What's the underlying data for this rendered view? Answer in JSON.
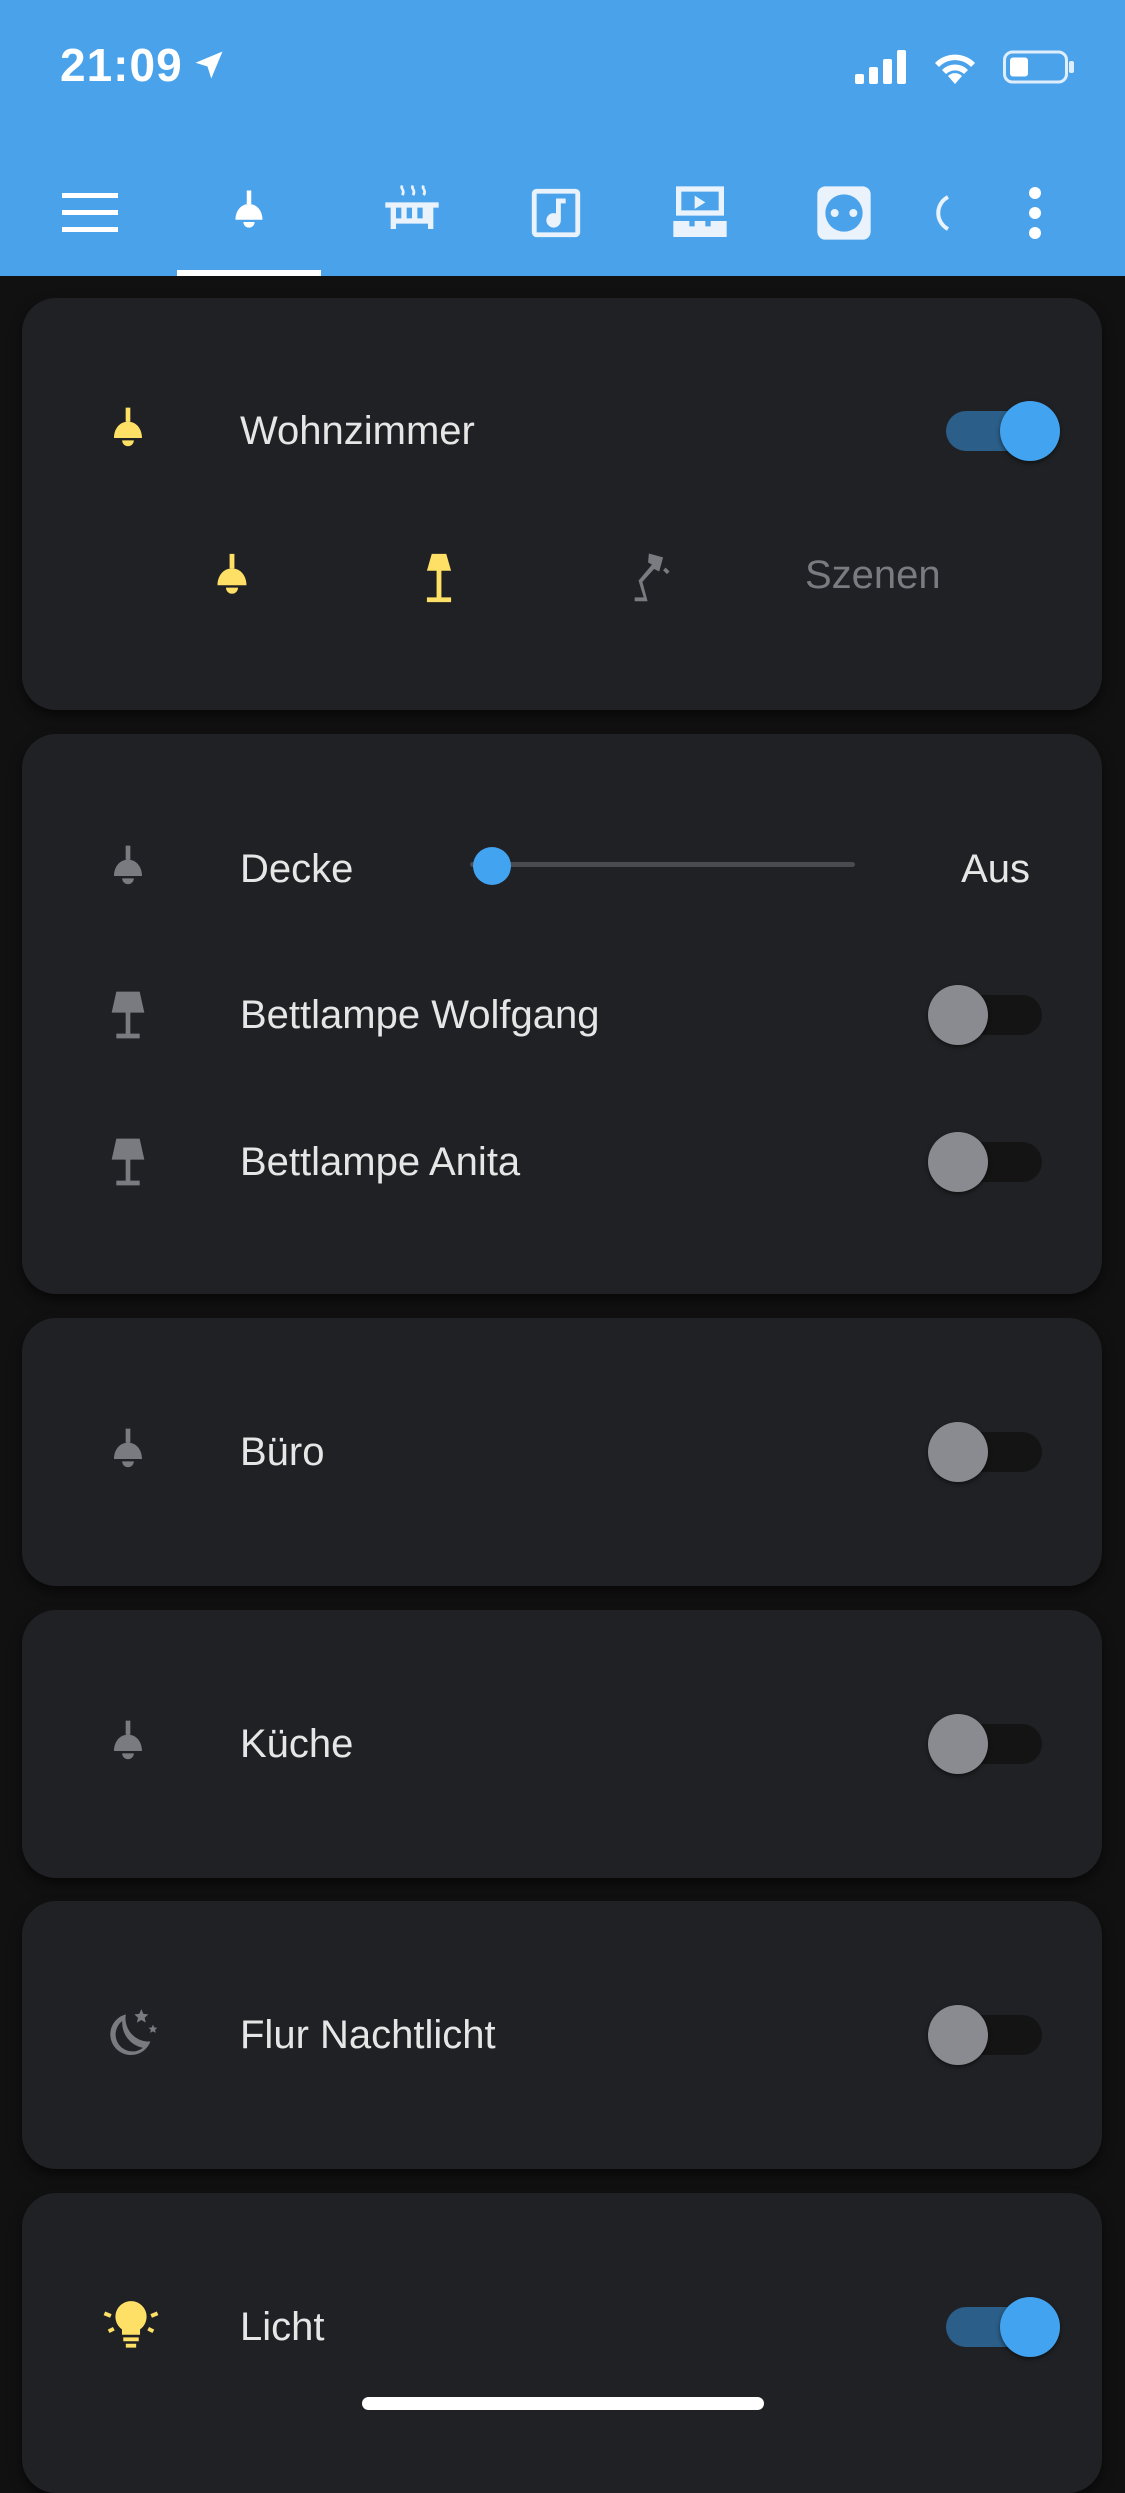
{
  "status_bar": {
    "time": "21:09"
  },
  "colors": {
    "app_bar": "#4aa3ea",
    "card": "#202124",
    "accent_on": "#42a3f0",
    "light_on": "#fde065",
    "icon_off": "#7a7b80"
  },
  "tabs": [
    {
      "icon": "ceiling-light-icon",
      "active": true
    },
    {
      "icon": "radiator-icon",
      "active": false
    },
    {
      "icon": "music-note-icon",
      "active": false
    },
    {
      "icon": "home-theater-icon",
      "active": false
    },
    {
      "icon": "power-socket-icon",
      "active": false
    },
    {
      "icon": "partial-tab-icon",
      "active": false
    }
  ],
  "wohnzimmer_card": {
    "title": "Wohnzimmer",
    "toggle_on": true,
    "scene_icons": [
      "ceiling-light-icon",
      "floor-lamp-icon",
      "desk-lamp-icon"
    ],
    "scenes_label": "Szenen"
  },
  "schlafzimmer_card": {
    "decke": {
      "label": "Decke",
      "state": "Aus",
      "brightness": 0
    },
    "bettlampe_wolfgang": {
      "label": "Bettlampe Wolfgang",
      "toggle_on": false
    },
    "bettlampe_anita": {
      "label": "Bettlampe Anita",
      "toggle_on": false
    }
  },
  "buero_card": {
    "label": "Büro",
    "toggle_on": false
  },
  "kueche_card": {
    "label": "Küche",
    "toggle_on": false
  },
  "flur_card": {
    "label": "Flur Nachtlicht",
    "toggle_on": false
  },
  "licht_card": {
    "label": "Licht",
    "toggle_on": true
  }
}
